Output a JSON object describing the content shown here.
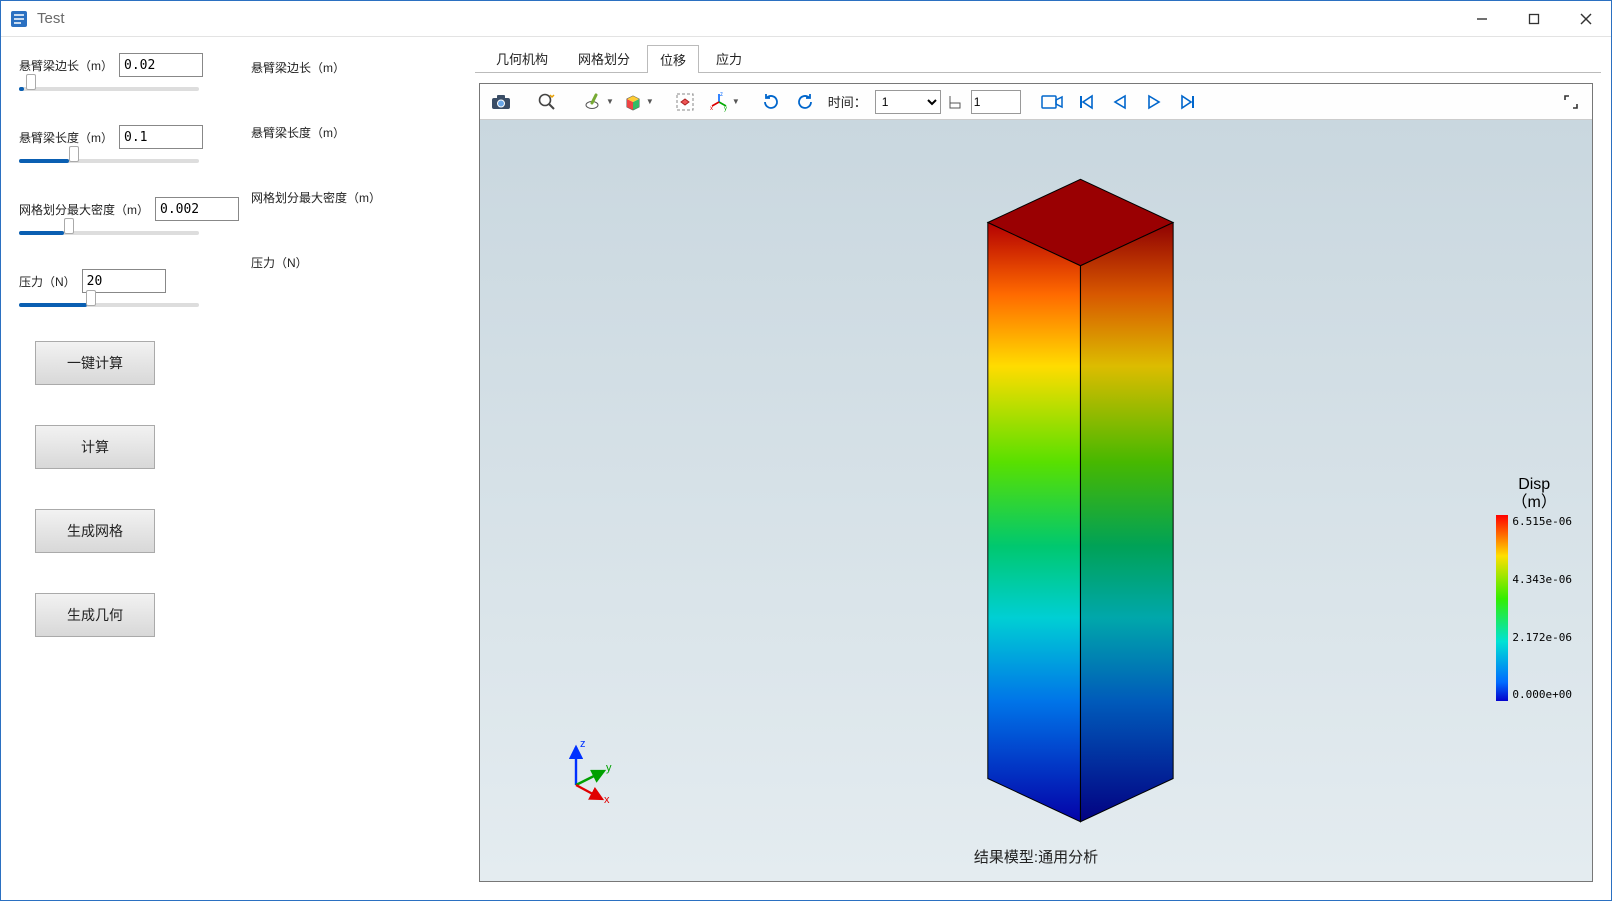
{
  "window": {
    "title": "Test"
  },
  "params": {
    "edge": {
      "label": "悬臂梁边长（m）",
      "value": "0.02",
      "slider_pct": 3
    },
    "length": {
      "label": "悬臂梁长度（m）",
      "value": "0.1",
      "slider_pct": 28
    },
    "mesh": {
      "label": "网格划分最大密度（m）",
      "value": "0.002",
      "slider_pct": 25
    },
    "force": {
      "label": "压力（N）",
      "value": "20",
      "slider_pct": 38
    }
  },
  "mid_labels": {
    "edge": "悬臂梁边长（m）",
    "length": "悬臂梁长度（m）",
    "mesh": "网格划分最大密度（m）",
    "force": "压力（N）"
  },
  "buttons": {
    "one_click": "一键计算",
    "compute": "计算",
    "gen_mesh": "生成网格",
    "gen_geom": "生成几何"
  },
  "tabs": [
    {
      "id": "geom",
      "label": "几何机构",
      "active": false
    },
    {
      "id": "mesh",
      "label": "网格划分",
      "active": false
    },
    {
      "id": "disp",
      "label": "位移",
      "active": true
    },
    {
      "id": "stress",
      "label": "应力",
      "active": false
    }
  ],
  "toolbar": {
    "time_label": "时间：",
    "time_select_value": "1",
    "time_spinner_value": "1"
  },
  "viewport": {
    "caption": "结果模型:通用分析",
    "axes": {
      "x": "x",
      "y": "y",
      "z": "z"
    }
  },
  "legend": {
    "title1": "Disp",
    "title2": "（m）",
    "ticks": [
      "6.515e-06",
      "4.343e-06",
      "2.172e-06",
      "0.000e+00"
    ]
  },
  "chart_data": {
    "type": "heatmap",
    "title": "结果模型:通用分析",
    "quantity": "Disp (m)",
    "colorbar_range": [
      0.0,
      6.515e-06
    ],
    "colorbar_ticks": [
      {
        "value": 6.515e-06,
        "label": "6.515e-06"
      },
      {
        "value": 4.343e-06,
        "label": "4.343e-06"
      },
      {
        "value": 2.172e-06,
        "label": "2.172e-06"
      },
      {
        "value": 0.0,
        "label": "0.000e+00"
      }
    ],
    "geometry": "rectangular cantilever beam",
    "orientation_axis": "z",
    "gradient_direction": "increasing along +z (blue at base, red at top)",
    "colormap": "rainbow"
  }
}
